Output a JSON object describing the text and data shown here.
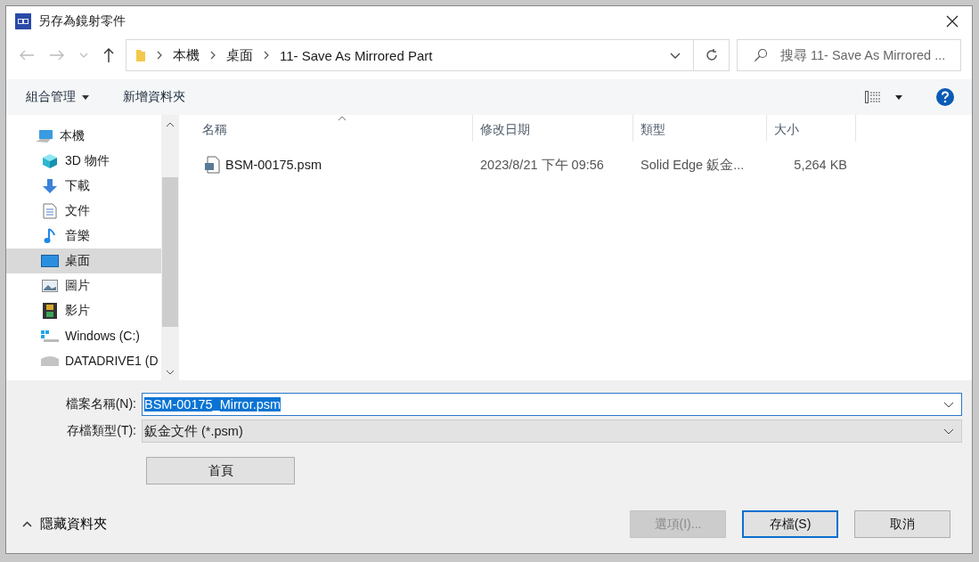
{
  "window": {
    "title": "另存為鏡射零件"
  },
  "address": {
    "breadcrumbs": [
      "本機",
      "桌面",
      "11- Save As Mirrored Part"
    ]
  },
  "search": {
    "placeholder": "搜尋 11- Save As Mirrored ..."
  },
  "toolbar": {
    "organize": "組合管理",
    "new_folder": "新增資料夾"
  },
  "sidebar": {
    "items": [
      {
        "label": "本機",
        "kind": "computer",
        "selected": false,
        "children": [
          {
            "label": "3D 物件",
            "kind": "cube",
            "selected": false
          },
          {
            "label": "下載",
            "kind": "download",
            "selected": false
          },
          {
            "label": "文件",
            "kind": "document",
            "selected": false
          },
          {
            "label": "音樂",
            "kind": "music",
            "selected": false
          },
          {
            "label": "桌面",
            "kind": "desktop",
            "selected": true
          },
          {
            "label": "圖片",
            "kind": "pictures",
            "selected": false
          },
          {
            "label": "影片",
            "kind": "videos",
            "selected": false
          },
          {
            "label": "Windows  (C:)",
            "kind": "drive",
            "selected": false
          },
          {
            "label": "DATADRIVE1 (D",
            "kind": "drive2",
            "selected": false
          }
        ]
      }
    ]
  },
  "table": {
    "columns": [
      "名稱",
      "修改日期",
      "類型",
      "大小"
    ],
    "rows": [
      {
        "name": "BSM-00175.psm",
        "modified": "2023/8/21 下午 09:56",
        "type": "Solid Edge 鈑金...",
        "size": "5,264 KB"
      }
    ]
  },
  "file_name": {
    "label": "檔案名稱(N):",
    "value": "BSM-00175_Mirror.psm"
  },
  "file_type": {
    "label": "存檔類型(T):",
    "value": "鈑金文件 (*.psm)"
  },
  "home_button": "首頁",
  "hide_folders": "隱藏資料夾",
  "buttons": [
    {
      "label": "選項(I)...",
      "disabled": true,
      "default": false
    },
    {
      "label": "存檔(S)",
      "disabled": false,
      "default": true
    },
    {
      "label": "取消",
      "disabled": false,
      "default": false
    }
  ]
}
